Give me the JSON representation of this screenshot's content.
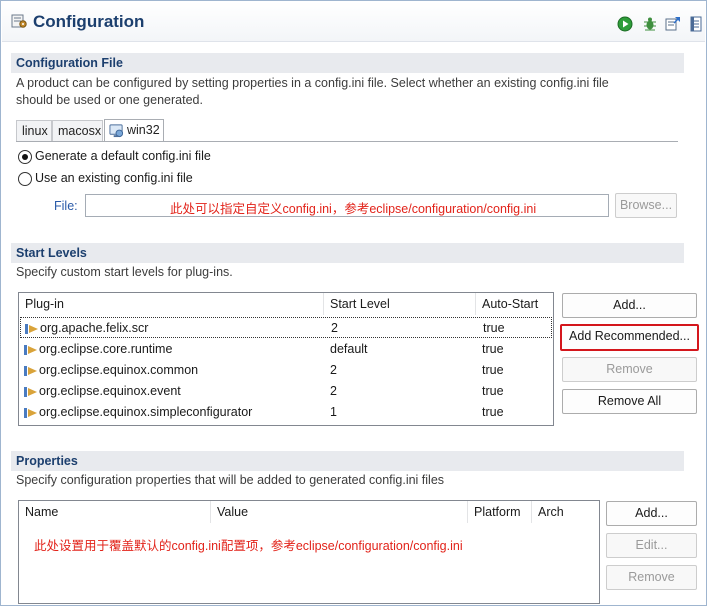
{
  "header": {
    "title": "Configuration",
    "toolbar_icons": [
      "run-icon",
      "debug-icon",
      "export-icon",
      "help-icon"
    ]
  },
  "config_file": {
    "section_title": "Configuration File",
    "description_line1": "A product can be configured by setting properties in a config.ini file.  Select whether an existing config.ini file",
    "description_line2": "should be used or one generated.",
    "tabs": [
      {
        "label": "linux"
      },
      {
        "label": "macosx"
      },
      {
        "label": "win32",
        "active": true
      }
    ],
    "radio_generate": "Generate a default config.ini file",
    "radio_existing": "Use an existing config.ini file",
    "radio_selected": "generate",
    "file_label": "File:",
    "file_value": "此处可以指定自定义config.ini，参考eclipse/configuration/config.ini",
    "browse_label": "Browse..."
  },
  "start_levels": {
    "section_title": "Start Levels",
    "description": "Specify custom start levels for plug-ins.",
    "columns": [
      "Plug-in",
      "Start Level",
      "Auto-Start"
    ],
    "rows": [
      {
        "plugin": "org.apache.felix.scr",
        "level": "2",
        "auto": "true"
      },
      {
        "plugin": "org.eclipse.core.runtime",
        "level": "default",
        "auto": "true"
      },
      {
        "plugin": "org.eclipse.equinox.common",
        "level": "2",
        "auto": "true"
      },
      {
        "plugin": "org.eclipse.equinox.event",
        "level": "2",
        "auto": "true"
      },
      {
        "plugin": "org.eclipse.equinox.simpleconfigurator",
        "level": "1",
        "auto": "true"
      }
    ],
    "add_label": "Add...",
    "add_recommended_label": "Add Recommended...",
    "remove_label": "Remove",
    "remove_all_label": "Remove All"
  },
  "properties": {
    "section_title": "Properties",
    "description": "Specify configuration properties that will be added to generated config.ini files",
    "columns": [
      "Name",
      "Value",
      "Platform",
      "Arch"
    ],
    "note": "此处设置用于覆盖默认的config.ini配置项，参考eclipse/configuration/config.ini",
    "add_label": "Add...",
    "edit_label": "Edit...",
    "remove_label": "Remove"
  },
  "colors": {
    "title": "#1c3f6e",
    "annotation_red": "#e2231a",
    "highlight_border": "#d4161c"
  }
}
